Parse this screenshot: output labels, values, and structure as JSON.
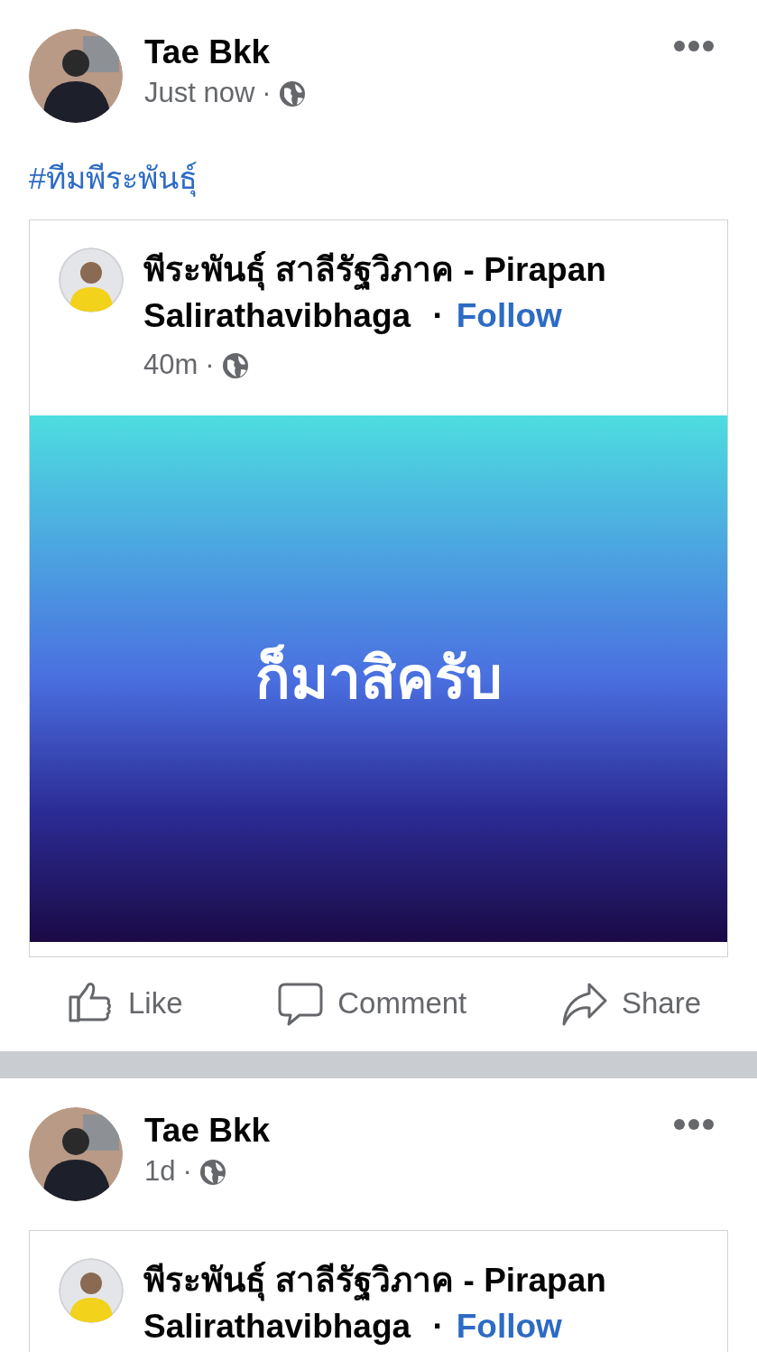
{
  "posts": [
    {
      "author": "Tae Bkk",
      "time": "Just now",
      "separator": "·",
      "text": "#ทีมพีระพันธุ์",
      "shared": {
        "page_name_lines": [
          "พีระพันธุ์ สาลีรัฐวิภาค - Pirapan",
          "Salirathavibhaga"
        ],
        "bullet": "·",
        "follow": "Follow",
        "time": "40m",
        "separator": "·",
        "background_text": "ก็มาสิครับ"
      },
      "actions": [
        {
          "kind": "like",
          "label": "Like"
        },
        {
          "kind": "comment",
          "label": "Comment"
        },
        {
          "kind": "share",
          "label": "Share"
        }
      ]
    },
    {
      "author": "Tae Bkk",
      "time": "1d",
      "separator": "·",
      "shared": {
        "page_name_lines": [
          "พีระพันธุ์ สาลีรัฐวิภาค - Pirapan",
          "Salirathavibhaga"
        ],
        "bullet": "·",
        "follow": "Follow"
      }
    }
  ]
}
